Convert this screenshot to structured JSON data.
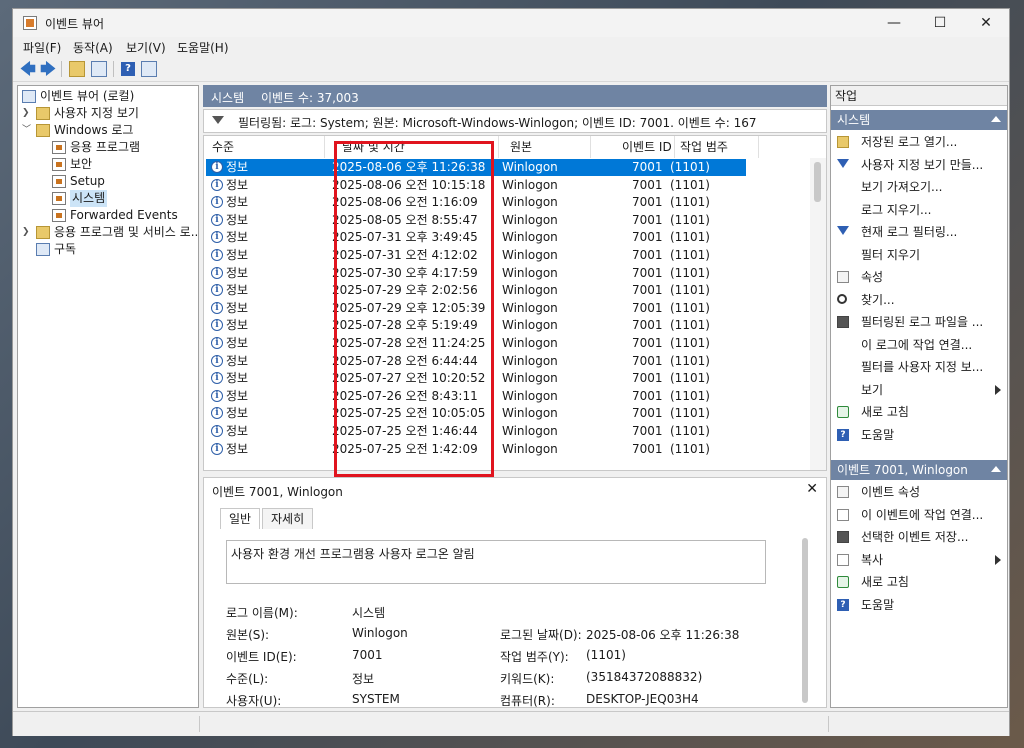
{
  "window": {
    "title": "이벤트 뷰어",
    "minimize": "—",
    "maximize": "☐",
    "close": "✕"
  },
  "menu": [
    "파일(F)",
    "동작(A)",
    "보기(V)",
    "도움말(H)"
  ],
  "toolbar": {
    "back": "🡄",
    "forward": "🡆",
    "help": "?"
  },
  "tree": {
    "root": "이벤트 뷰어 (로컬)",
    "custom_views": "사용자 지정 보기",
    "windows_logs": "Windows 로그",
    "children": [
      "응용 프로그램",
      "보안",
      "Setup",
      "시스템",
      "Forwarded Events"
    ],
    "app_services": "응용 프로그램 및 서비스 로...",
    "subscriptions": "구독"
  },
  "center": {
    "log_name": "시스템",
    "event_count": "이벤트 수: 37,003",
    "filter": "필터링됨: 로그: System; 원본: Microsoft-Windows-Winlogon; 이벤트 ID: 7001. 이벤트 수: 167",
    "columns": {
      "level": "수준",
      "datetime": "날짜 및 시간",
      "source": "원본",
      "event_id": "이벤트 ID",
      "category": "작업 범주"
    },
    "rows": [
      {
        "level": "정보",
        "datetime": "2025-08-06 오후 11:26:38",
        "source": "Winlogon",
        "event_id": "7001",
        "category": "(1101)"
      },
      {
        "level": "정보",
        "datetime": "2025-08-06 오전 10:15:18",
        "source": "Winlogon",
        "event_id": "7001",
        "category": "(1101)"
      },
      {
        "level": "정보",
        "datetime": "2025-08-06 오전 1:16:09",
        "source": "Winlogon",
        "event_id": "7001",
        "category": "(1101)"
      },
      {
        "level": "정보",
        "datetime": "2025-08-05 오전 8:55:47",
        "source": "Winlogon",
        "event_id": "7001",
        "category": "(1101)"
      },
      {
        "level": "정보",
        "datetime": "2025-07-31 오후 3:49:45",
        "source": "Winlogon",
        "event_id": "7001",
        "category": "(1101)"
      },
      {
        "level": "정보",
        "datetime": "2025-07-31 오전 4:12:02",
        "source": "Winlogon",
        "event_id": "7001",
        "category": "(1101)"
      },
      {
        "level": "정보",
        "datetime": "2025-07-30 오후 4:17:59",
        "source": "Winlogon",
        "event_id": "7001",
        "category": "(1101)"
      },
      {
        "level": "정보",
        "datetime": "2025-07-29 오후 2:02:56",
        "source": "Winlogon",
        "event_id": "7001",
        "category": "(1101)"
      },
      {
        "level": "정보",
        "datetime": "2025-07-29 오후 12:05:39",
        "source": "Winlogon",
        "event_id": "7001",
        "category": "(1101)"
      },
      {
        "level": "정보",
        "datetime": "2025-07-28 오후 5:19:49",
        "source": "Winlogon",
        "event_id": "7001",
        "category": "(1101)"
      },
      {
        "level": "정보",
        "datetime": "2025-07-28 오전 11:24:25",
        "source": "Winlogon",
        "event_id": "7001",
        "category": "(1101)"
      },
      {
        "level": "정보",
        "datetime": "2025-07-28 오전 6:44:44",
        "source": "Winlogon",
        "event_id": "7001",
        "category": "(1101)"
      },
      {
        "level": "정보",
        "datetime": "2025-07-27 오전 10:20:52",
        "source": "Winlogon",
        "event_id": "7001",
        "category": "(1101)"
      },
      {
        "level": "정보",
        "datetime": "2025-07-26 오전 8:43:11",
        "source": "Winlogon",
        "event_id": "7001",
        "category": "(1101)"
      },
      {
        "level": "정보",
        "datetime": "2025-07-25 오전 10:05:05",
        "source": "Winlogon",
        "event_id": "7001",
        "category": "(1101)"
      },
      {
        "level": "정보",
        "datetime": "2025-07-25 오전 1:46:44",
        "source": "Winlogon",
        "event_id": "7001",
        "category": "(1101)"
      },
      {
        "level": "정보",
        "datetime": "2025-07-25 오전 1:42:09",
        "source": "Winlogon",
        "event_id": "7001",
        "category": "(1101)"
      }
    ]
  },
  "detail": {
    "title": "이벤트 7001, Winlogon",
    "tabs": [
      "일반",
      "자세히"
    ],
    "message": "사용자 환경 개선 프로그램용 사용자 로그온 알림",
    "fields": {
      "log_name_label": "로그 이름(M):",
      "log_name": "시스템",
      "source_label": "원본(S):",
      "source": "Winlogon",
      "logged_label": "로그된 날짜(D):",
      "logged": "2025-08-06 오후 11:26:38",
      "event_id_label": "이벤트 ID(E):",
      "event_id": "7001",
      "category_label": "작업 범주(Y):",
      "category": "(1101)",
      "level_label": "수준(L):",
      "level": "정보",
      "keywords_label": "키워드(K):",
      "keywords": "(35184372088832)",
      "user_label": "사용자(U):",
      "user": "SYSTEM",
      "computer_label": "컴퓨터(R):",
      "computer": "DESKTOP-JEQ03H4"
    }
  },
  "actions": {
    "header": "작업",
    "section1": "시스템",
    "items1": [
      "저장된 로그 열기...",
      "사용자 지정 보기 만들...",
      "보기 가져오기...",
      "로그 지우기...",
      "현재 로그 필터링...",
      "필터 지우기",
      "속성",
      "찾기...",
      "필터링된 로그 파일을 ...",
      "이 로그에 작업 연결...",
      "필터를 사용자 지정 보...",
      "보기",
      "새로 고침",
      "도움말"
    ],
    "section2": "이벤트 7001, Winlogon",
    "items2": [
      "이벤트 속성",
      "이 이벤트에 작업 연결...",
      "선택한 이벤트 저장...",
      "복사",
      "새로 고침",
      "도움말"
    ]
  },
  "colors": {
    "section_bg": "#6f84a3",
    "selected_row": "#0078d7",
    "highlight_box": "#e0141e"
  }
}
